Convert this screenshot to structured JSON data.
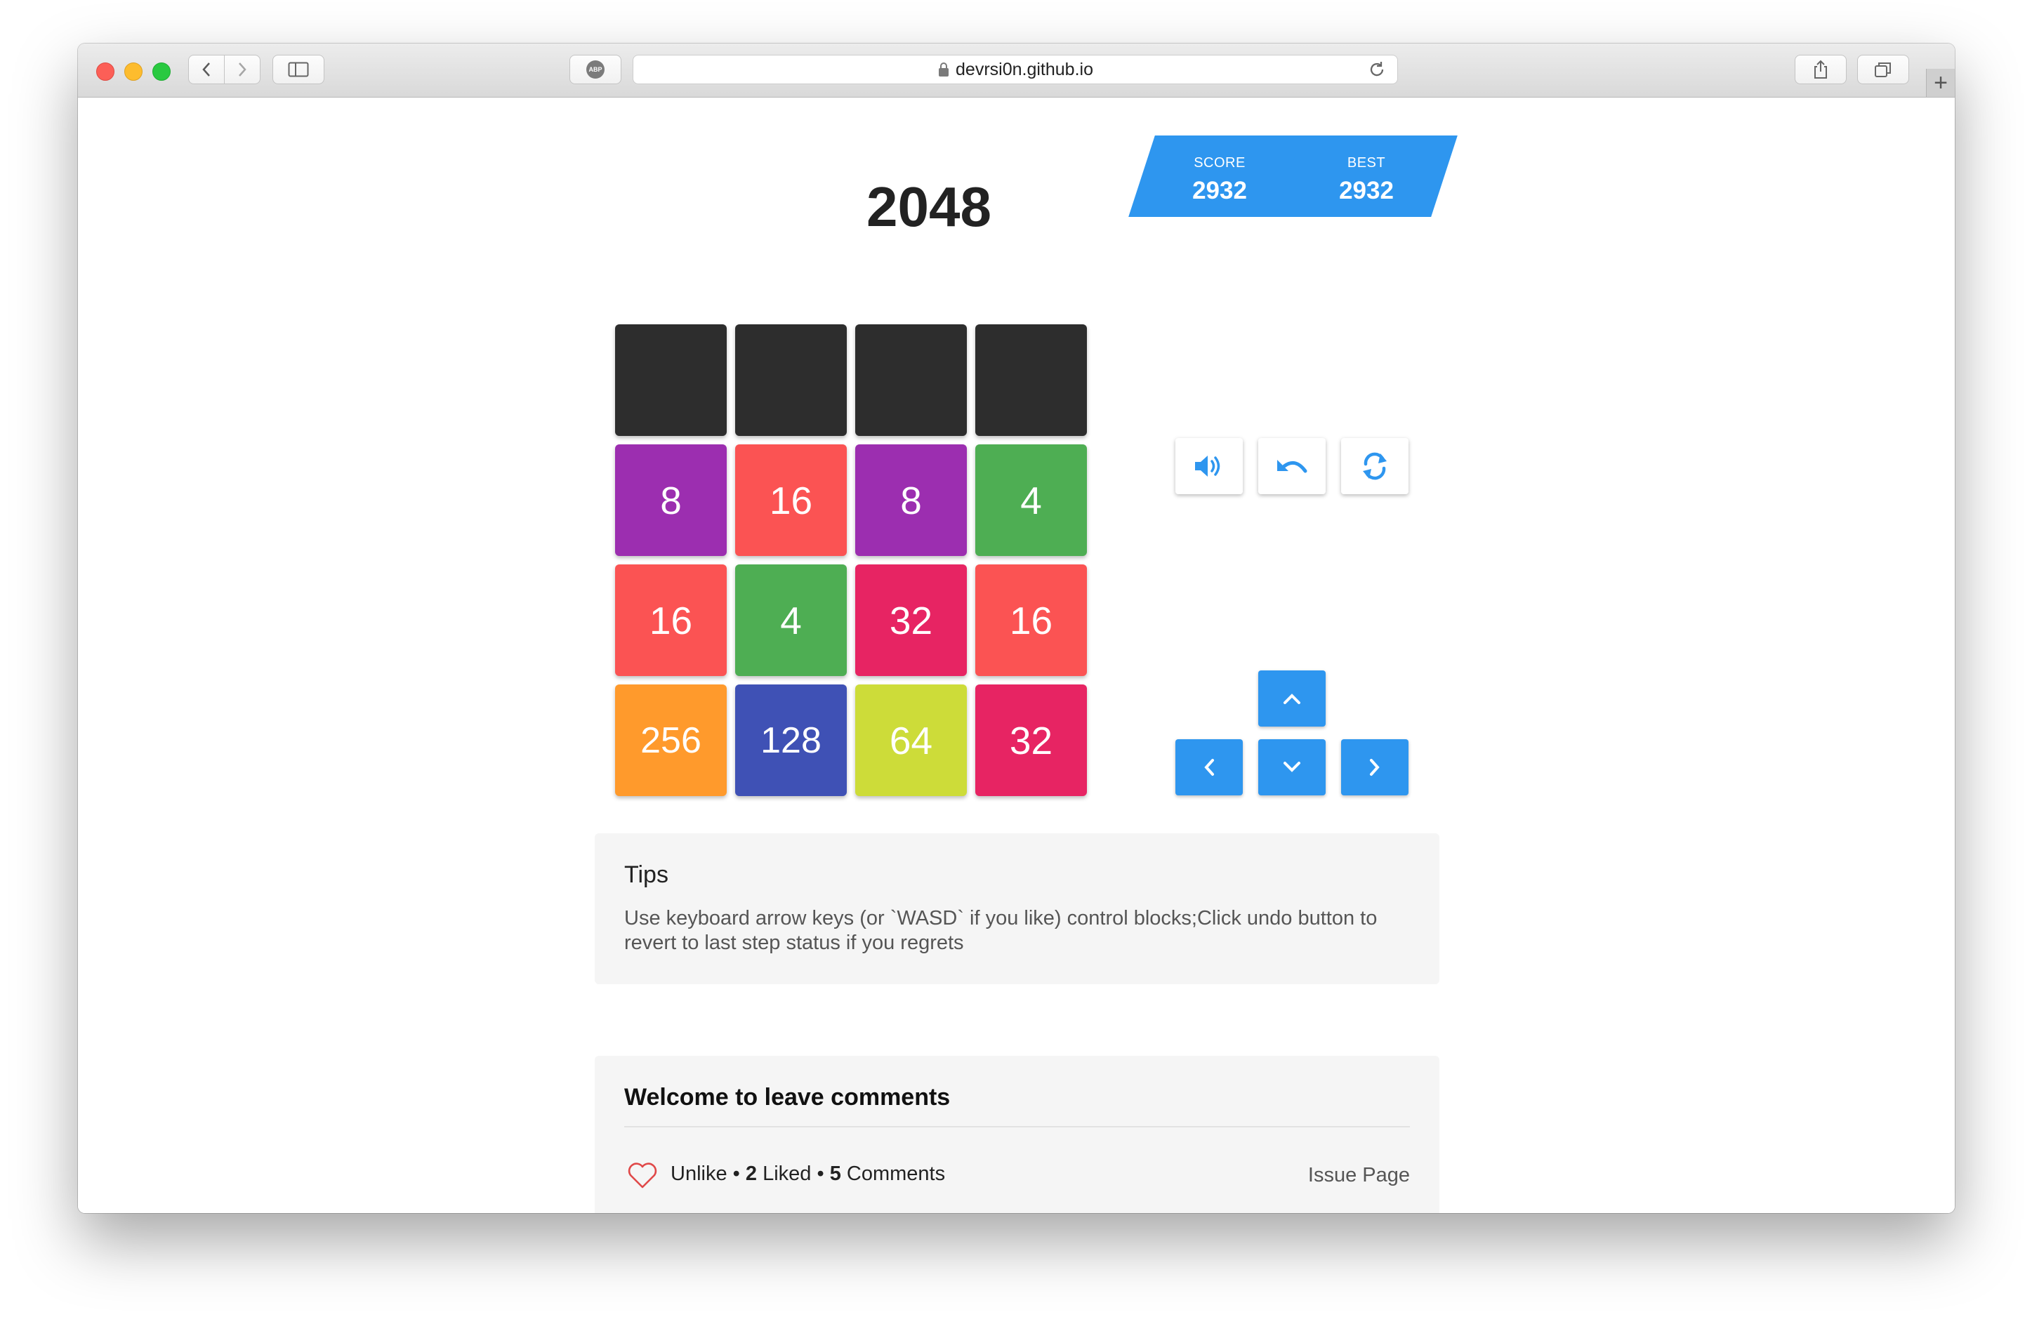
{
  "browser": {
    "url": "devrsi0n.github.io",
    "adblock_label": "ABP",
    "new_tab_label": "+"
  },
  "game": {
    "title": "2048",
    "score": {
      "label": "SCORE",
      "value": "2932"
    },
    "best": {
      "label": "BEST",
      "value": "2932"
    },
    "tiles": [
      {
        "value": "",
        "color": "#2d2d2d"
      },
      {
        "value": "",
        "color": "#2d2d2d"
      },
      {
        "value": "",
        "color": "#2d2d2d"
      },
      {
        "value": "",
        "color": "#2d2d2d"
      },
      {
        "value": "8",
        "color": "#9c2eb0"
      },
      {
        "value": "16",
        "color": "#fb5353"
      },
      {
        "value": "8",
        "color": "#9c2eb0"
      },
      {
        "value": "4",
        "color": "#4eae53"
      },
      {
        "value": "16",
        "color": "#fb5353"
      },
      {
        "value": "4",
        "color": "#4eae53"
      },
      {
        "value": "32",
        "color": "#e72463"
      },
      {
        "value": "16",
        "color": "#fb5353"
      },
      {
        "value": "256",
        "color": "#ff9a2c"
      },
      {
        "value": "128",
        "color": "#3f51b5"
      },
      {
        "value": "64",
        "color": "#cddc39"
      },
      {
        "value": "32",
        "color": "#e72463"
      }
    ],
    "controls": {
      "sound_icon": "volume-icon",
      "undo_icon": "undo-icon",
      "restart_icon": "refresh-icon",
      "up_icon": "chevron-up-icon",
      "left_icon": "chevron-left-icon",
      "down_icon": "chevron-down-icon",
      "right_icon": "chevron-right-icon"
    },
    "accent_color": "#2e96ef"
  },
  "tips": {
    "title": "Tips",
    "text": "Use keyboard arrow keys (or `WASD` if you like) control blocks;Click undo button to revert to last step status if you regrets"
  },
  "comments": {
    "title": "Welcome to leave comments",
    "unlike_label": "Unlike",
    "separator": "•",
    "liked_count": "2",
    "liked_label": "Liked",
    "comment_count": "5",
    "comment_label": "Comments",
    "issue_page_label": "Issue Page"
  }
}
